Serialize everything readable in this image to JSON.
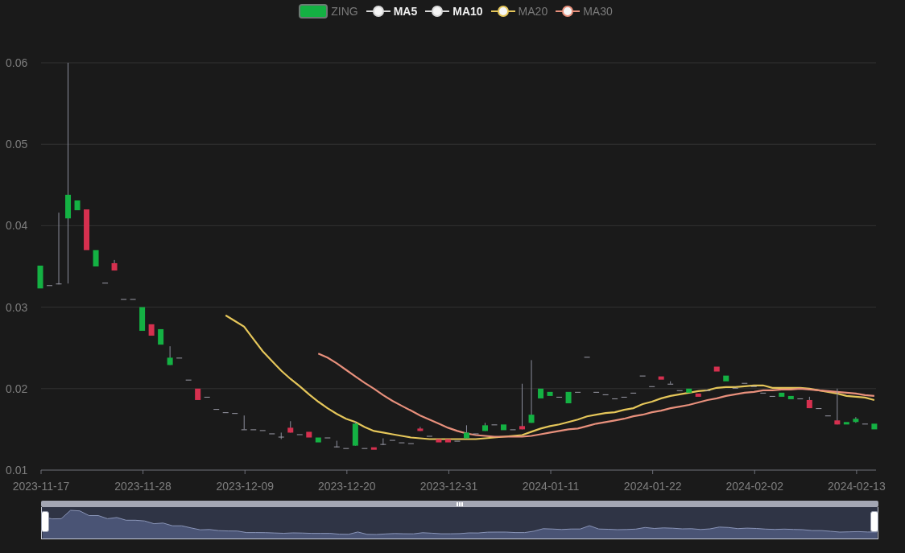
{
  "legend": [
    {
      "label": "ZING",
      "kind": "candle",
      "color": "#14b143",
      "highlighted": false
    },
    {
      "label": "MA5",
      "kind": "line",
      "color": "#d8d8d8",
      "highlighted": true
    },
    {
      "label": "MA10",
      "kind": "line",
      "color": "#d8d8d8",
      "highlighted": true
    }
  ],
  "chart": {
    "chart_data": {
      "type": "candlestick",
      "grid": true,
      "categories": [
        "2023-11-17",
        null,
        null,
        null,
        null,
        null,
        null,
        null,
        null,
        null,
        null,
        "2023-11-28",
        null,
        null,
        null,
        null,
        null,
        null,
        null,
        null,
        null,
        null,
        "2023-12-09",
        null,
        null,
        null,
        null,
        null,
        null,
        null,
        null,
        null,
        null,
        "2023-12-20",
        null,
        null,
        null,
        null,
        null,
        null,
        null,
        null,
        null,
        null,
        "2023-12-31",
        null,
        null,
        null,
        null,
        null,
        null,
        null,
        null,
        null,
        null,
        "2024-01-11",
        null,
        null,
        null,
        null,
        null,
        null,
        null,
        null,
        null,
        null,
        "2024-01-22",
        null,
        null,
        null,
        null,
        null,
        null,
        null,
        null,
        null,
        null,
        "2024-02-02",
        null,
        null,
        null,
        null,
        null,
        null,
        null,
        null,
        null,
        null,
        "2024-02-13",
        null,
        null
      ],
      "ylim": [
        0.01,
        0.06
      ],
      "yticks": [
        0.01,
        0.02,
        0.03,
        0.04,
        0.05,
        0.06
      ],
      "ohlc": [
        [
          0.0323,
          0.0351,
          0.0323,
          0.0351
        ],
        [
          0.0327,
          0.0327,
          0.0327,
          0.0327
        ],
        [
          0.0329,
          0.0416,
          0.0328,
          0.0329
        ],
        [
          0.0409,
          0.06,
          0.0329,
          0.0438
        ],
        [
          0.0419,
          0.0431,
          0.0419,
          0.0431
        ],
        [
          0.042,
          0.042,
          0.037,
          0.037
        ],
        [
          0.035,
          0.037,
          0.035,
          0.037
        ],
        [
          0.033,
          0.033,
          0.033,
          0.033
        ],
        [
          0.0354,
          0.0358,
          0.0345,
          0.0345
        ],
        [
          0.031,
          0.031,
          0.031,
          0.031
        ],
        [
          0.031,
          0.031,
          0.031,
          0.031
        ],
        [
          0.0271,
          0.03,
          0.0271,
          0.03
        ],
        [
          0.0279,
          0.0279,
          0.0265,
          0.0265
        ],
        [
          0.0254,
          0.0273,
          0.0254,
          0.0273
        ],
        [
          0.0229,
          0.0252,
          0.0229,
          0.0238
        ],
        [
          0.0238,
          0.0238,
          0.0238,
          0.0238
        ],
        [
          0.0211,
          0.0211,
          0.0211,
          0.0211
        ],
        [
          0.02,
          0.02,
          0.0186,
          0.0186
        ],
        [
          0.019,
          0.019,
          0.019,
          0.019
        ],
        [
          0.0175,
          0.0175,
          0.0175,
          0.0175
        ],
        [
          0.0171,
          0.0171,
          0.0171,
          0.0171
        ],
        [
          0.017,
          0.017,
          0.017,
          0.017
        ],
        [
          0.015,
          0.0167,
          0.015,
          0.015
        ],
        [
          0.015,
          0.015,
          0.015,
          0.015
        ],
        [
          0.0149,
          0.0149,
          0.0149,
          0.0149
        ],
        [
          0.0145,
          0.0145,
          0.0145,
          0.0145
        ],
        [
          0.0141,
          0.0146,
          0.0138,
          0.0141
        ],
        [
          0.0152,
          0.016,
          0.0146,
          0.0146
        ],
        [
          0.0144,
          0.0144,
          0.0144,
          0.0144
        ],
        [
          0.0147,
          0.0147,
          0.014,
          0.014
        ],
        [
          0.0134,
          0.014,
          0.0134,
          0.014
        ],
        [
          0.014,
          0.014,
          0.014,
          0.014
        ],
        [
          0.0129,
          0.0136,
          0.0128,
          0.0129
        ],
        [
          0.0127,
          0.0127,
          0.0127,
          0.0127
        ],
        [
          0.013,
          0.016,
          0.013,
          0.0157
        ],
        [
          0.0127,
          0.0127,
          0.0127,
          0.0127
        ],
        [
          0.0128,
          0.0128,
          0.0125,
          0.0125
        ],
        [
          0.0132,
          0.0139,
          0.0131,
          0.0132
        ],
        [
          0.0137,
          0.0137,
          0.0137,
          0.0137
        ],
        [
          0.0134,
          0.0134,
          0.0134,
          0.0134
        ],
        [
          0.0133,
          0.0133,
          0.0133,
          0.0133
        ],
        [
          0.0151,
          0.0153,
          0.0148,
          0.0148
        ],
        [
          0.0142,
          0.0142,
          0.0142,
          0.0142
        ],
        [
          0.0138,
          0.0138,
          0.0134,
          0.0134
        ],
        [
          0.0138,
          0.0138,
          0.0134,
          0.0134
        ],
        [
          0.0136,
          0.0136,
          0.0136,
          0.0136
        ],
        [
          0.0139,
          0.0155,
          0.0139,
          0.0146
        ],
        [
          0.0145,
          0.0145,
          0.0145,
          0.0145
        ],
        [
          0.0148,
          0.0158,
          0.0148,
          0.0155
        ],
        [
          0.0156,
          0.0156,
          0.0156,
          0.0156
        ],
        [
          0.0149,
          0.0156,
          0.0149,
          0.0156
        ],
        [
          0.015,
          0.015,
          0.015,
          0.015
        ],
        [
          0.0154,
          0.0206,
          0.015,
          0.015
        ],
        [
          0.0158,
          0.0235,
          0.0158,
          0.0168
        ],
        [
          0.0188,
          0.02,
          0.0188,
          0.02
        ],
        [
          0.0191,
          0.0196,
          0.0191,
          0.0196
        ],
        [
          0.019,
          0.019,
          0.019,
          0.019
        ],
        [
          0.0182,
          0.0196,
          0.0182,
          0.0196
        ],
        [
          0.0196,
          0.0196,
          0.0196,
          0.0196
        ],
        [
          0.0239,
          0.0239,
          0.0239,
          0.0239
        ],
        [
          0.0196,
          0.0196,
          0.0196,
          0.0196
        ],
        [
          0.0193,
          0.0193,
          0.0193,
          0.0193
        ],
        [
          0.0188,
          0.0188,
          0.0188,
          0.0188
        ],
        [
          0.019,
          0.019,
          0.019,
          0.019
        ],
        [
          0.0195,
          0.0195,
          0.0195,
          0.0195
        ],
        [
          0.0216,
          0.0216,
          0.0216,
          0.0216
        ],
        [
          0.0203,
          0.0203,
          0.0203,
          0.0203
        ],
        [
          0.0215,
          0.0215,
          0.0211,
          0.0211
        ],
        [
          0.0206,
          0.0209,
          0.0206,
          0.0206
        ],
        [
          0.0198,
          0.0198,
          0.0198,
          0.0198
        ],
        [
          0.0195,
          0.02,
          0.0195,
          0.02
        ],
        [
          0.0194,
          0.0194,
          0.019,
          0.019
        ],
        [
          0.0198,
          0.0198,
          0.0198,
          0.0198
        ],
        [
          0.0227,
          0.0227,
          0.0221,
          0.0221
        ],
        [
          0.0209,
          0.0216,
          0.0209,
          0.0216
        ],
        [
          0.0201,
          0.0201,
          0.0201,
          0.0201
        ],
        [
          0.0207,
          0.0207,
          0.0207,
          0.0207
        ],
        [
          0.0203,
          0.0203,
          0.0203,
          0.0203
        ],
        [
          0.0195,
          0.0195,
          0.0195,
          0.0195
        ],
        [
          0.0191,
          0.0191,
          0.0191,
          0.0191
        ],
        [
          0.019,
          0.0195,
          0.019,
          0.0195
        ],
        [
          0.0187,
          0.0191,
          0.0187,
          0.0191
        ],
        [
          0.0188,
          0.0188,
          0.0188,
          0.0188
        ],
        [
          0.0186,
          0.019,
          0.0176,
          0.0176
        ],
        [
          0.0176,
          0.0176,
          0.0176,
          0.0176
        ],
        [
          0.0167,
          0.0167,
          0.0167,
          0.0167
        ],
        [
          0.0161,
          0.02,
          0.0156,
          0.0156
        ],
        [
          0.0156,
          0.0159,
          0.0156,
          0.0159
        ],
        [
          0.0159,
          0.0165,
          0.0158,
          0.0163
        ],
        [
          0.0157,
          0.0157,
          0.0157,
          0.0157
        ],
        [
          0.015,
          0.0157,
          0.015,
          0.0157
        ]
      ],
      "series": [
        {
          "name": "MA20",
          "type": "line",
          "color": "#e5c65a",
          "values": [
            null,
            null,
            null,
            null,
            null,
            null,
            null,
            null,
            null,
            null,
            null,
            null,
            null,
            null,
            null,
            null,
            null,
            null,
            null,
            null,
            0.029,
            0.0283,
            0.0276,
            0.0261,
            0.0246,
            0.0234,
            0.0222,
            0.0212,
            0.0203,
            0.0193,
            0.0184,
            0.0176,
            0.0169,
            0.0163,
            0.0159,
            0.0153,
            0.0148,
            0.0146,
            0.0144,
            0.0142,
            0.014,
            0.0139,
            0.0138,
            0.0138,
            0.0138,
            0.0138,
            0.0138,
            0.0138,
            0.0139,
            0.014,
            0.0141,
            0.0142,
            0.0143,
            0.0147,
            0.0151,
            0.0154,
            0.0156,
            0.0159,
            0.0162,
            0.0166,
            0.0168,
            0.017,
            0.0171,
            0.0174,
            0.0176,
            0.0181,
            0.0184,
            0.0188,
            0.0191,
            0.0193,
            0.0195,
            0.0197,
            0.0198,
            0.0201,
            0.0202,
            0.0202,
            0.0203,
            0.0204,
            0.0204,
            0.0201,
            0.0201,
            0.0201,
            0.0201,
            0.02,
            0.0198,
            0.0196,
            0.0194,
            0.0191,
            0.019,
            0.0189,
            0.0186
          ]
        },
        {
          "name": "MA30",
          "type": "line",
          "color": "#e8907c",
          "values": [
            null,
            null,
            null,
            null,
            null,
            null,
            null,
            null,
            null,
            null,
            null,
            null,
            null,
            null,
            null,
            null,
            null,
            null,
            null,
            null,
            null,
            null,
            null,
            null,
            null,
            null,
            null,
            null,
            null,
            null,
            0.0243,
            0.0238,
            0.0231,
            0.0223,
            0.0215,
            0.0207,
            0.02,
            0.0192,
            0.0185,
            0.0179,
            0.0173,
            0.0167,
            0.0162,
            0.0157,
            0.0152,
            0.0148,
            0.0145,
            0.0143,
            0.0142,
            0.0141,
            0.0141,
            0.0141,
            0.0141,
            0.0142,
            0.0144,
            0.0146,
            0.0148,
            0.015,
            0.0151,
            0.0154,
            0.0157,
            0.0159,
            0.0161,
            0.0163,
            0.0166,
            0.0168,
            0.0171,
            0.0173,
            0.0176,
            0.0178,
            0.018,
            0.0183,
            0.0186,
            0.0188,
            0.0191,
            0.0193,
            0.0195,
            0.0196,
            0.0198,
            0.0198,
            0.0199,
            0.0199,
            0.02,
            0.0199,
            0.0198,
            0.0197,
            0.0196,
            0.0195,
            0.0194,
            0.0192,
            0.0191
          ]
        }
      ]
    }
  }
}
